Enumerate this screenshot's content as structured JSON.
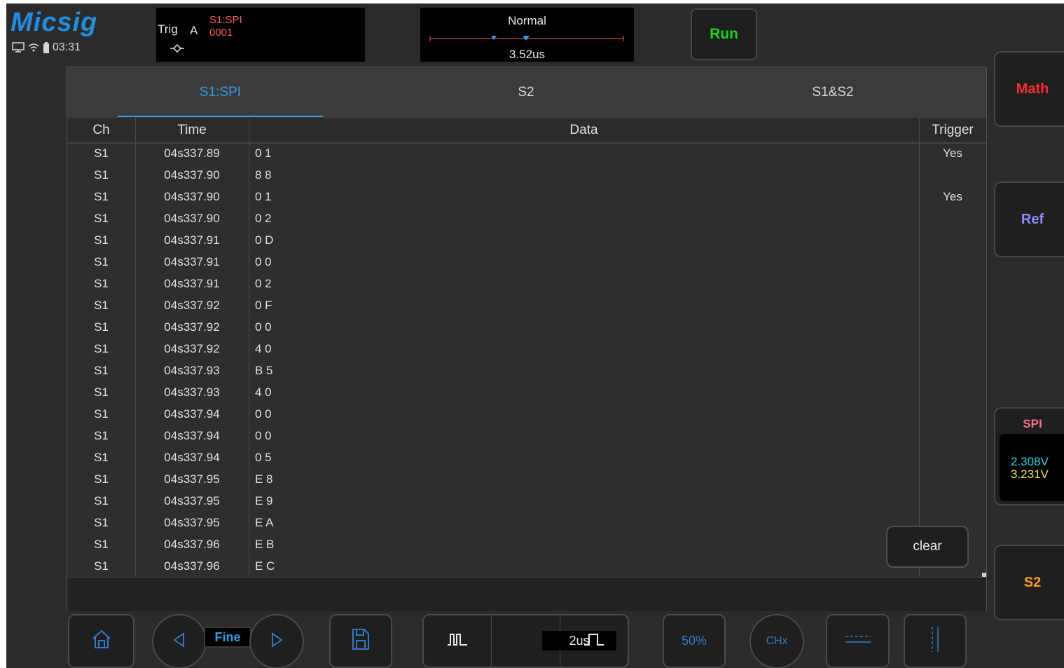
{
  "header": {
    "logo": "Micsig",
    "clock": "03:31",
    "trigger": {
      "label": "Trig",
      "channel": "A",
      "source": "S1:SPI",
      "value": "0001"
    },
    "timebase": {
      "mode": "Normal",
      "position": "3.52us"
    },
    "run_label": "Run"
  },
  "side": {
    "math_label": "Math",
    "ref_label": "Ref",
    "spi": {
      "title": "SPI",
      "v1": "2.308V",
      "v2": "3.231V"
    },
    "s2_label": "S2"
  },
  "tabs": [
    {
      "label": "S1:SPI",
      "active": true
    },
    {
      "label": "S2",
      "active": false
    },
    {
      "label": "S1&S2",
      "active": false
    }
  ],
  "table": {
    "headers": {
      "ch": "Ch",
      "time": "Time",
      "data": "Data",
      "trigger": "Trigger"
    },
    "rows": [
      {
        "ch": "S1",
        "time": "04s337.89",
        "data": "0 1",
        "trigger": "Yes"
      },
      {
        "ch": "S1",
        "time": "04s337.90",
        "data": "8 8",
        "trigger": ""
      },
      {
        "ch": "S1",
        "time": "04s337.90",
        "data": "0 1",
        "trigger": "Yes"
      },
      {
        "ch": "S1",
        "time": "04s337.90",
        "data": "0 2",
        "trigger": ""
      },
      {
        "ch": "S1",
        "time": "04s337.91",
        "data": "0 D",
        "trigger": ""
      },
      {
        "ch": "S1",
        "time": "04s337.91",
        "data": "0 0",
        "trigger": ""
      },
      {
        "ch": "S1",
        "time": "04s337.91",
        "data": "0 2",
        "trigger": ""
      },
      {
        "ch": "S1",
        "time": "04s337.92",
        "data": "0 F",
        "trigger": ""
      },
      {
        "ch": "S1",
        "time": "04s337.92",
        "data": "0 0",
        "trigger": ""
      },
      {
        "ch": "S1",
        "time": "04s337.92",
        "data": "4 0",
        "trigger": ""
      },
      {
        "ch": "S1",
        "time": "04s337.93",
        "data": "B 5",
        "trigger": ""
      },
      {
        "ch": "S1",
        "time": "04s337.93",
        "data": "4 0",
        "trigger": ""
      },
      {
        "ch": "S1",
        "time": "04s337.94",
        "data": "0 0",
        "trigger": ""
      },
      {
        "ch": "S1",
        "time": "04s337.94",
        "data": "0 0",
        "trigger": ""
      },
      {
        "ch": "S1",
        "time": "04s337.94",
        "data": "0 5",
        "trigger": ""
      },
      {
        "ch": "S1",
        "time": "04s337.95",
        "data": "E 8",
        "trigger": ""
      },
      {
        "ch": "S1",
        "time": "04s337.95",
        "data": "E 9",
        "trigger": ""
      },
      {
        "ch": "S1",
        "time": "04s337.95",
        "data": "E A",
        "trigger": ""
      },
      {
        "ch": "S1",
        "time": "04s337.96",
        "data": "E B",
        "trigger": ""
      },
      {
        "ch": "S1",
        "time": "04s337.96",
        "data": "E C",
        "trigger": ""
      }
    ]
  },
  "clear_label": "clear",
  "toolbar": {
    "fine_label": "Fine",
    "time_div": "2us",
    "half_label": "50%",
    "chx_label": "CHx"
  },
  "colors": {
    "accent": "#2e9be6",
    "run": "#1cd41c",
    "math": "#ff2a2a",
    "ref": "#8c8cff",
    "spi": "#ff6b8a",
    "s2": "#ff9a1a"
  }
}
